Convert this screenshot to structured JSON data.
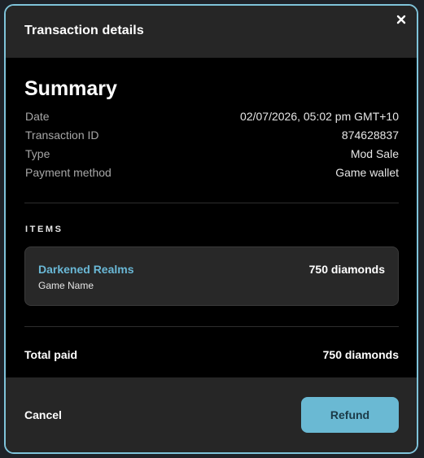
{
  "header": {
    "title": "Transaction details",
    "close_icon": "close-icon"
  },
  "summary": {
    "title": "Summary",
    "rows": [
      {
        "label": "Date",
        "value": "02/07/2026, 05:02 pm GMT+10"
      },
      {
        "label": "Transaction ID",
        "value": "874628837"
      },
      {
        "label": "Type",
        "value": "Mod Sale"
      },
      {
        "label": "Payment method",
        "value": "Game wallet"
      }
    ]
  },
  "items": {
    "heading": "ITEMS",
    "list": [
      {
        "name": "Darkened Realms",
        "subtitle": "Game Name",
        "price": "750 diamonds"
      }
    ]
  },
  "total": {
    "label": "Total paid",
    "value": "750 diamonds"
  },
  "footer": {
    "cancel_label": "Cancel",
    "refund_label": "Refund"
  },
  "colors": {
    "accent": "#6ab9d3",
    "border": "#7fc3da",
    "link": "#6ab8d6",
    "background": "#000000",
    "header_bg": "#262626"
  }
}
